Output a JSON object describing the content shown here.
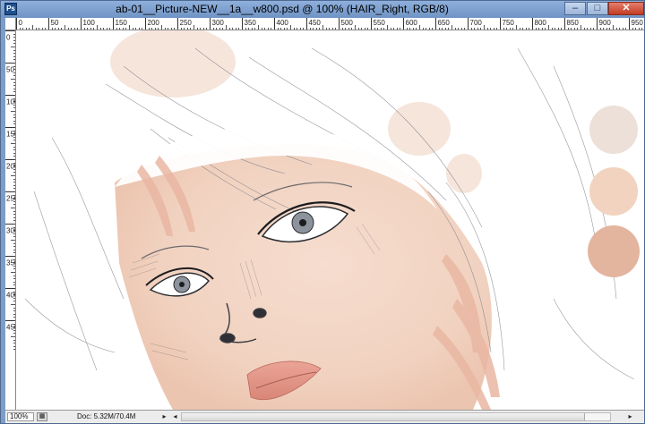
{
  "window": {
    "title": "ab-01__Picture-NEW__1a__w800.psd @ 100% (HAIR_Right, RGB/8)",
    "app_icon": "Ps",
    "minimize_glyph": "–",
    "maximize_glyph": "□",
    "close_glyph": "✕"
  },
  "rulers": {
    "top_labels": [
      "0",
      "50",
      "100",
      "150",
      "200",
      "250",
      "300",
      "350",
      "400",
      "450",
      "500",
      "550",
      "600",
      "650",
      "700",
      "750",
      "800",
      "850",
      "900",
      "950"
    ],
    "left_labels": [
      "0",
      "50",
      "100",
      "150",
      "200",
      "250",
      "300",
      "350",
      "400",
      "450"
    ]
  },
  "canvas": {
    "swatches": [
      "#ece0d9",
      "#f2d3bf",
      "#e4b59e"
    ]
  },
  "status": {
    "zoom": "100%",
    "doc_info": "Doc: 5.32M/70.4M",
    "left_arrow": "◂",
    "right_arrow": "▸"
  }
}
